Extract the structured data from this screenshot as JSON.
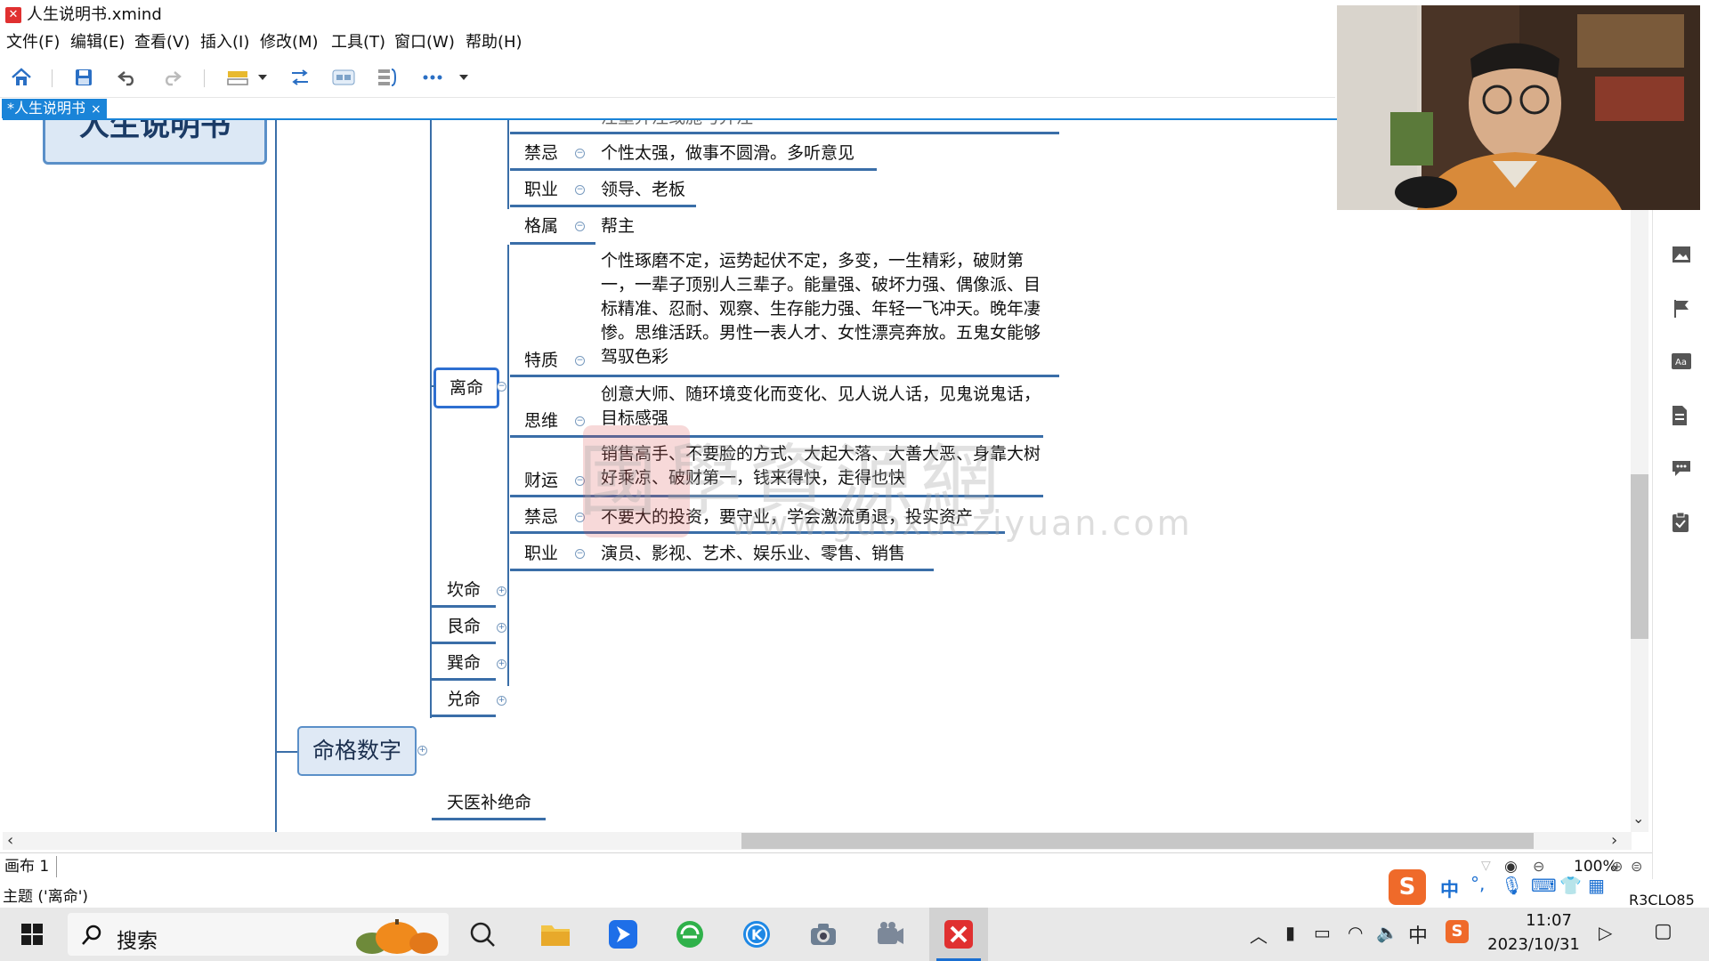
{
  "window": {
    "title": "人生说明书.xmind"
  },
  "menu": [
    "文件(F)",
    "编辑(E)",
    "查看(V)",
    "插入(I)",
    "修改(M)",
    "工具(T)",
    "窗口(W)",
    "帮助(H)"
  ],
  "toolbar": {
    "icons": [
      "home-icon",
      "save-icon",
      "undo-icon",
      "redo-icon",
      "topic-style-icon",
      "dropdown-icon",
      "relationship-icon",
      "boundary-icon",
      "summary-icon",
      "more-icon",
      "dropdown-icon"
    ]
  },
  "tab": {
    "label": "*人生说明书",
    "close": "×"
  },
  "mindmap": {
    "central_topic": "人生说明书",
    "top_partial": "注重弃注或施与弃注",
    "upper_rows": [
      {
        "label": "禁忌",
        "value": "个性太强，做事不圆滑。多听意见"
      },
      {
        "label": "职业",
        "value": "领导、老板"
      }
    ],
    "li_ming": {
      "label": "离命",
      "rows": [
        {
          "label": "格属",
          "value": "帮主"
        },
        {
          "label": "特质",
          "value": "个性琢磨不定，运势起伏不定，多变，一生精彩，破财第一，一辈子顶别人三辈子。能量强、破坏力强、偶像派、目标精准、忍耐、观察、生存能力强、年轻一飞冲天。晚年凄惨。思维活跃。男性一表人才、女性漂亮奔放。五鬼女能够驾驭色彩"
        },
        {
          "label": "思维",
          "value": "创意大师、随环境变化而变化、见人说人话，见鬼说鬼话，目标感强"
        },
        {
          "label": "财运",
          "value": "销售高手、不要脸的方式、大起大落、大善大恶、身靠大树好乘凉、破财第一，钱来得快，走得也快"
        },
        {
          "label": "禁忌",
          "value": "不要大的投资，要守业，学会激流勇退，投实资产"
        },
        {
          "label": "职业",
          "value": "演员、影视、艺术、娱乐业、零售、销售"
        }
      ]
    },
    "siblings": [
      "坎命",
      "艮命",
      "巽命",
      "兑命"
    ],
    "mingge_shuzi": "命格数字",
    "bottom_topic": "天医补绝命",
    "watermark_cn": "國學資源網",
    "watermark_en": "www.guoxueziyuan.com"
  },
  "sheet": {
    "label": "画布 1",
    "zoom": "100%"
  },
  "status": {
    "text": "主题 ('离命')",
    "ime_code": "R3CLO85"
  },
  "taskbar": {
    "search": "搜索",
    "ime": "中",
    "time": "11:07",
    "date": "2023/10/31"
  }
}
